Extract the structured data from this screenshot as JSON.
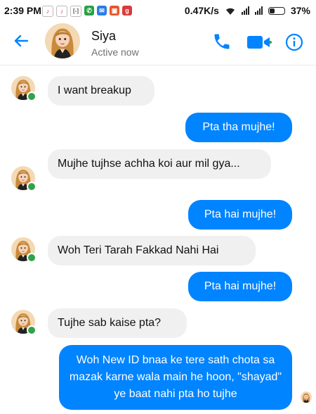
{
  "status_bar": {
    "time": "2:39 PM",
    "network_speed": "0.47K/s",
    "battery_percent": "37%",
    "battery_level": 0.37,
    "app_icons": [
      "tiktok-icon",
      "tiktok-icon",
      "sim-icon",
      "whatsapp-icon",
      "messenger-icon",
      "app-icon",
      "gallery-icon"
    ]
  },
  "header": {
    "contact_name": "Siya",
    "presence": "Active now",
    "icons": [
      "back-arrow-icon",
      "phone-icon",
      "video-camera-icon",
      "info-icon"
    ],
    "accent_color": "#0084ff"
  },
  "messages": [
    {
      "direction": "in",
      "text": "I want breakup"
    },
    {
      "direction": "out",
      "text": "Pta tha mujhe!"
    },
    {
      "direction": "in",
      "text": "Mujhe tujhse achha koi aur mil gya..."
    },
    {
      "direction": "out",
      "text": "Pta hai mujhe!"
    },
    {
      "direction": "in",
      "text": "Woh Teri Tarah Fakkad Nahi Hai"
    },
    {
      "direction": "out",
      "text": "Pta hai mujhe!"
    },
    {
      "direction": "in",
      "text": "Tujhe sab kaise pta?"
    },
    {
      "direction": "out",
      "text": "Woh New ID bnaa ke tere sath chota sa mazak karne wala main he hoon, \"shayad\" ye baat nahi pta ho tujhe"
    }
  ],
  "colors": {
    "outgoing_bubble": "#0084ff",
    "incoming_bubble": "#f1f0f0",
    "online_dot": "#31a24c"
  }
}
